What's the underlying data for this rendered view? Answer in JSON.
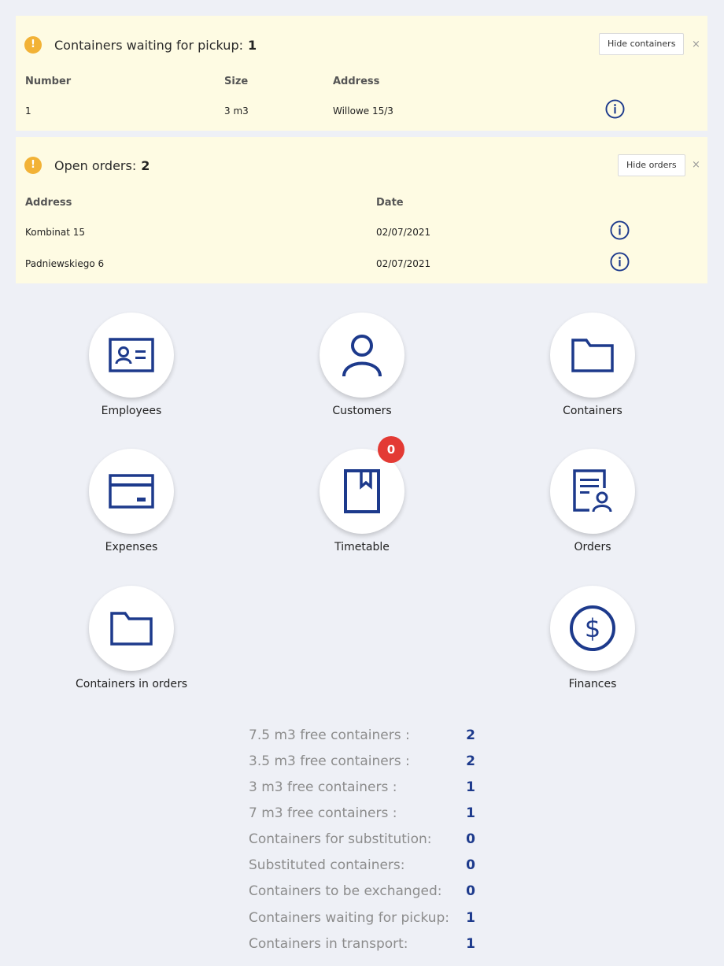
{
  "pickup_alert": {
    "title": "Containers waiting for pickup:",
    "count": "1",
    "hide_label": "Hide containers",
    "close": "×",
    "columns": [
      "Number",
      "Size",
      "Address"
    ],
    "rows": [
      {
        "number": "1",
        "size": "3 m3",
        "address": "Willowe 15/3"
      }
    ]
  },
  "orders_alert": {
    "title": "Open orders:",
    "count": "2",
    "hide_label": "Hide orders",
    "close": "×",
    "columns": [
      "Address",
      "Date"
    ],
    "rows": [
      {
        "address": "Kombinat 15",
        "date": "02/07/2021"
      },
      {
        "address": "Padniewskiego 6",
        "date": "02/07/2021"
      }
    ]
  },
  "tiles": [
    {
      "label": "Employees",
      "icon": "id-card-icon"
    },
    {
      "label": "Customers",
      "icon": "user-icon"
    },
    {
      "label": "Containers",
      "icon": "folder-icon"
    },
    {
      "label": "Expenses",
      "icon": "credit-card-icon"
    },
    {
      "label": "Timetable",
      "icon": "book-icon",
      "badge": "0"
    },
    {
      "label": "Orders",
      "icon": "document-user-icon"
    },
    {
      "label": "Containers in orders",
      "icon": "folder-icon"
    },
    {
      "label": "Finances",
      "icon": "dollar-icon"
    }
  ],
  "stats": [
    {
      "label": "7.5 m3 free containers :",
      "value": "2"
    },
    {
      "label": "3.5 m3 free containers :",
      "value": "2"
    },
    {
      "label": "3 m3 free containers :",
      "value": "1"
    },
    {
      "label": "7 m3 free containers :",
      "value": "1"
    },
    {
      "label": "Containers for substitution:",
      "value": "0"
    },
    {
      "label": "Substituted containers:",
      "value": "0"
    },
    {
      "label": "Containers to be exchanged:",
      "value": "0"
    },
    {
      "label": "Containers waiting for pickup:",
      "value": "1"
    },
    {
      "label": "Containers in transport:",
      "value": "1"
    }
  ],
  "colors": {
    "accent": "#1d3a8c",
    "alert_bg": "#fefbe3",
    "warning": "#f2b236",
    "badge": "#e33a34"
  }
}
